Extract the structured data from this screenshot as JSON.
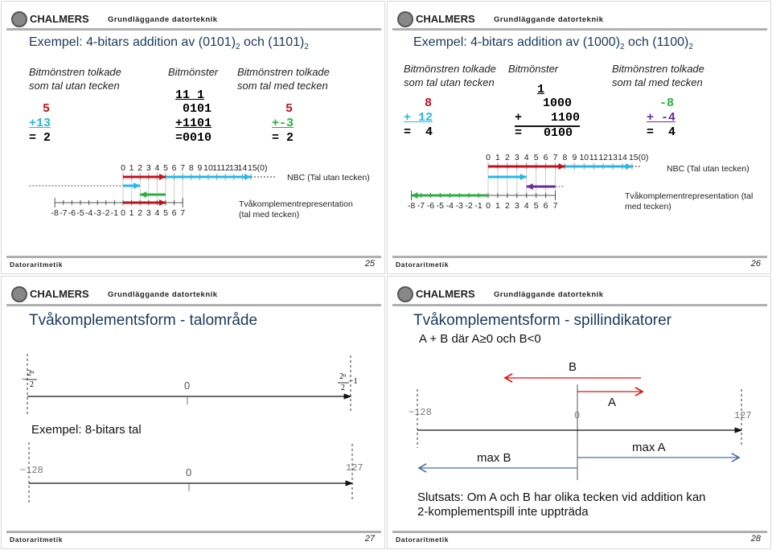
{
  "header": {
    "brand": "CHALMERS",
    "course": "Grundläggande datorteknik",
    "footer": "Datoraritmetik"
  },
  "colors": {
    "red": "#c0121c",
    "cyan": "#25b8e6",
    "green": "#28b040",
    "purple": "#6a2c9a",
    "blue": "#4a6fa5",
    "title": "#1b3a5c"
  },
  "slides": [
    {
      "page": "25",
      "title": "Exempel: 4-bitars addition av (0101)",
      "title_sub1": "2",
      "title_mid": " och (1101)",
      "title_sub2": "2",
      "col1": [
        "Bitmönstren tolkade",
        "som tal utan tecken"
      ],
      "col2": "Bitmönster",
      "col3": [
        "Bitmönstren tolkade",
        "som tal med tecken"
      ],
      "unsigned": [
        "5",
        "+13",
        "= 2"
      ],
      "bits": {
        "carry": "11 1",
        "a": "0101",
        "b": "+1101",
        "sum": "=0010"
      },
      "signed": [
        "5",
        "+-3",
        "= 2"
      ],
      "numberline": {
        "top_ticks": [
          "0",
          "1",
          "2",
          "3",
          "4",
          "5",
          "6",
          "7",
          "8",
          "9",
          "10",
          "11",
          "12",
          "13",
          "14",
          "15(0)"
        ],
        "bottom_ticks": [
          "-8",
          "-7",
          "-6",
          "-5",
          "-4",
          "-3",
          "-2",
          "-1",
          "0",
          "1",
          "2",
          "3",
          "4",
          "5",
          "6",
          "7"
        ],
        "nbc_label": "NBC (Tal utan tecken)",
        "tc_label": [
          "Tvåkomplementrepresentation",
          "(tal med tecken)"
        ]
      }
    },
    {
      "page": "26",
      "title": "Exempel: 4-bitars addition av (1000)",
      "title_sub1": "2",
      "title_mid": " och (1100)",
      "title_sub2": "2",
      "col1": [
        "Bitmönstren tolkade",
        "som tal utan tecken"
      ],
      "col2": "Bitmönster",
      "col3": [
        "Bitmönstren tolkade",
        "som tal med tecken"
      ],
      "unsigned": [
        "8",
        "+ 12",
        "=  4"
      ],
      "bits": {
        "carry": "1",
        "a": "1000",
        "b": "+    1100",
        "sum": "=   0100"
      },
      "signed": [
        "-8",
        "+ -4",
        "=  4"
      ],
      "numberline": {
        "top_ticks": [
          "0",
          "1",
          "2",
          "3",
          "4",
          "5",
          "6",
          "7",
          "8",
          "9",
          "10",
          "11",
          "12",
          "13",
          "14",
          "15(0)"
        ],
        "bottom_ticks": [
          "-8",
          "-7",
          "-6",
          "-5",
          "-4",
          "-3",
          "-2",
          "-1",
          "0",
          "1",
          "2",
          "3",
          "4",
          "5",
          "6",
          "7"
        ],
        "nbc_label": "NBC (Tal utan tecken)",
        "tc_label": [
          "Tvåkomplementrepresentation (tal",
          "med tecken)"
        ]
      }
    },
    {
      "page": "27",
      "title": "Tvåkomplementsform - talområde",
      "min_num": "2ⁿ",
      "min_den": "2",
      "max_num": "2ⁿ",
      "max_den": "2",
      "max_suffix": "−1",
      "zero": "0",
      "example": "Exempel: 8-bitars tal",
      "ex_min": "−128",
      "ex_zero": "0",
      "ex_max": "127"
    },
    {
      "page": "28",
      "title": "Tvåkomplementsform - spillindikatorer",
      "condition": "A + B där A≥0 och B<0",
      "b_label": "B",
      "a_label": "A",
      "min": "−128",
      "zero": "0",
      "max": "127",
      "max_a": "max A",
      "max_b": "max B",
      "conclusion": [
        "Slutsats: Om A och B har olika tecken vid addition kan",
        "2-komplementspill inte uppträda"
      ]
    }
  ]
}
